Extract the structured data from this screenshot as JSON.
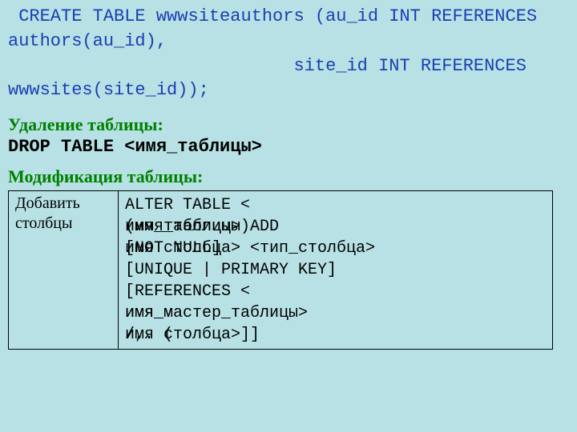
{
  "sql_block": " CREATE TABLE wwwsiteauthors (au_id INT REFERENCES authors(au_id),\n                           site_id INT REFERENCES wwwsites(site_id));",
  "delete_heading": "Удаление таблицы:",
  "drop_stmt": "DROP TABLE <имя_таблицы>",
  "modify_heading": "Модификация таблицы:",
  "table": {
    "left": "Добавить столбцы",
    "lines": {
      "l1_front": "ALTER TABLE <",
      "l2_front": "имя_таблицы> ADD",
      "l2_back": "(имя_таблицы)",
      "l3_front": "имя столбца> <тип_столбца>",
      "l3_back": "[NOT NULL]",
      "l4": "[UNIQUE | PRIMARY KEY]",
      "l5": "[REFERENCES <",
      "l6_front": "имя_мастер_таблицы>",
      "l6_back": "имя_м",
      "l7_front": "имя столбца>]]",
      "l7_back": "/,. ("
    }
  }
}
